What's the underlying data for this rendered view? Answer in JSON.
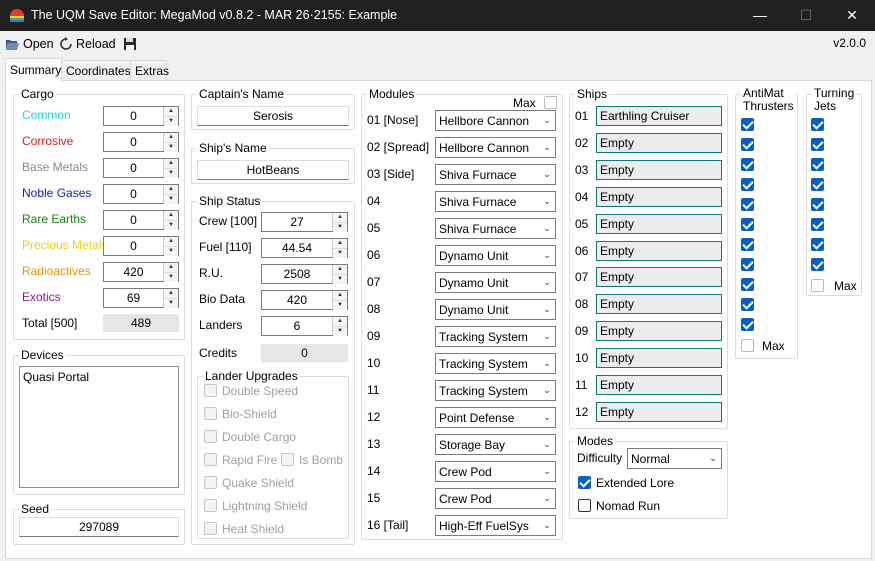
{
  "window": {
    "title": "The UQM Save Editor: MegaMod v0.8.2 - MAR 26·2155: Example",
    "min_glyph": "—",
    "max_glyph": "☐",
    "close_glyph": "✕"
  },
  "toolbar": {
    "open_label": "Open",
    "reload_label": "Reload",
    "version": "v2.0.0"
  },
  "tabs": [
    "Summary",
    "Coordinates",
    "Extras"
  ],
  "cargo": {
    "title": "Cargo",
    "items": [
      {
        "label": "Common",
        "value": "0",
        "color": "#22d3d3"
      },
      {
        "label": "Corrosive",
        "value": "0",
        "color": "#e01818"
      },
      {
        "label": "Base Metals",
        "value": "0",
        "color": "#8a8a8a"
      },
      {
        "label": "Noble Gases",
        "value": "0",
        "color": "#1818c8"
      },
      {
        "label": "Rare Earths",
        "value": "0",
        "color": "#128212"
      },
      {
        "label": "Precious Metals",
        "value": "0",
        "color": "#f0d000"
      },
      {
        "label": "Radioactives",
        "value": "420",
        "color": "#f09000"
      },
      {
        "label": "Exotics",
        "value": "69",
        "color": "#8a1a9a"
      }
    ],
    "total_label": "Total  [500]",
    "total_value": "489"
  },
  "devices": {
    "title": "Devices",
    "items": [
      "Quasi Portal"
    ]
  },
  "seed": {
    "title": "Seed",
    "value": "297089"
  },
  "captain": {
    "title": "Captain's Name",
    "value": "Serosis"
  },
  "ship_name": {
    "title": "Ship's Name",
    "value": "HotBeans"
  },
  "status": {
    "title": "Ship Status",
    "items": [
      {
        "label": "Crew [100]",
        "value": "27"
      },
      {
        "label": "Fuel  [110]",
        "value": "44.54"
      },
      {
        "label": "R.U.",
        "value": "2508"
      },
      {
        "label": "Bio Data",
        "value": "420"
      },
      {
        "label": "Landers",
        "value": "6"
      }
    ],
    "credits_label": "Credits",
    "credits_value": "0"
  },
  "lander_upgrades": {
    "title": "Lander Upgrades",
    "items": [
      "Double Speed",
      "Bio-Shield",
      "Double Cargo",
      "Rapid Fire",
      "Is Bomb",
      "Quake Shield",
      "Lightning Shield",
      "Heat Shield"
    ]
  },
  "modules": {
    "title": "Modules",
    "max_label": "Max",
    "slots": [
      {
        "label": "01 [Nose]",
        "value": "Hellbore Cannon"
      },
      {
        "label": "02 [Spread]",
        "value": "Hellbore Cannon"
      },
      {
        "label": "03 [Side]",
        "value": "Shiva Furnace"
      },
      {
        "label": "04",
        "value": "Shiva Furnace"
      },
      {
        "label": "05",
        "value": "Shiva Furnace"
      },
      {
        "label": "06",
        "value": "Dynamo Unit"
      },
      {
        "label": "07",
        "value": "Dynamo Unit"
      },
      {
        "label": "08",
        "value": "Dynamo Unit"
      },
      {
        "label": "09",
        "value": "Tracking System"
      },
      {
        "label": "10",
        "value": "Tracking System"
      },
      {
        "label": "11",
        "value": "Tracking System"
      },
      {
        "label": "12",
        "value": "Point Defense"
      },
      {
        "label": "13",
        "value": "Storage Bay"
      },
      {
        "label": "14",
        "value": "Crew Pod"
      },
      {
        "label": "15",
        "value": "Crew Pod"
      },
      {
        "label": "16 [Tail]",
        "value": "High-Eff FuelSys"
      }
    ]
  },
  "ships": {
    "title": "Ships",
    "items": [
      {
        "label": "01",
        "value": "Earthling Cruiser"
      },
      {
        "label": "02",
        "value": "Empty"
      },
      {
        "label": "03",
        "value": "Empty"
      },
      {
        "label": "04",
        "value": "Empty"
      },
      {
        "label": "05",
        "value": "Empty"
      },
      {
        "label": "06",
        "value": "Empty"
      },
      {
        "label": "07",
        "value": "Empty"
      },
      {
        "label": "08",
        "value": "Empty"
      },
      {
        "label": "09",
        "value": "Empty"
      },
      {
        "label": "10",
        "value": "Empty"
      },
      {
        "label": "11",
        "value": "Empty"
      },
      {
        "label": "12",
        "value": "Empty"
      }
    ]
  },
  "modes": {
    "title": "Modes",
    "difficulty_label": "Difficulty",
    "difficulty_value": "Normal",
    "extended_lore": "Extended Lore",
    "nomad_run": "Nomad Run"
  },
  "antimat": {
    "title_line1": "AntiMat",
    "title_line2": "Thrusters",
    "count": 11,
    "max_label": "Max"
  },
  "turning": {
    "title_line1": "Turning",
    "title_line2": "Jets",
    "count": 8,
    "max_label": "Max"
  }
}
